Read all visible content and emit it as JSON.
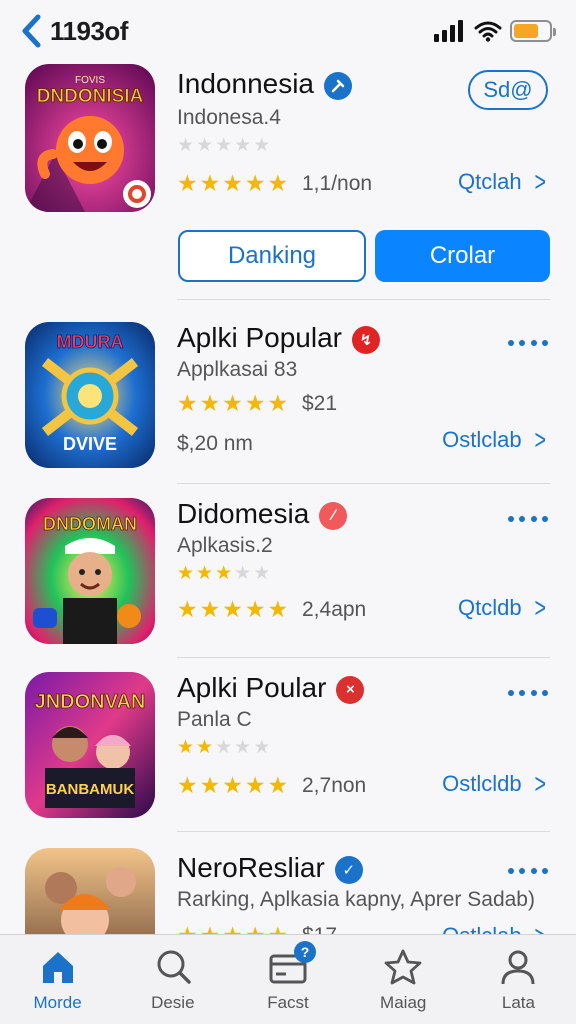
{
  "status_bar": {
    "back_label": "1193of",
    "battery_color": "#f5a623",
    "battery_level": 0.7
  },
  "featured": {
    "icon_text": "FOVIS",
    "icon_title": "DNDONISIA",
    "title": "Indonnesia",
    "subtitle": "Indonesa.4",
    "small_rating": 0,
    "rating": 4.5,
    "rating_count": "1,1/non",
    "pill_label": "Sd@",
    "link_label": "Qtclah",
    "button_secondary": "Danking",
    "button_primary": "Crolar",
    "badge_color": "#1a73c8"
  },
  "apps": [
    {
      "icon_top": "MDURA",
      "icon_bottom": "DVIVE",
      "title": "Aplki Popular",
      "subtitle": "Applkasai 83",
      "rating": 4.5,
      "price": "$21",
      "size": "$,20 nm",
      "link_label": "Ostlclab",
      "badge_color": "#e02424"
    },
    {
      "icon_top": "DNDOMAN",
      "title": "Didomesia",
      "subtitle": "Aplkasis.2",
      "small_rating": 3,
      "rating": 4.5,
      "meta": "2,4apn",
      "link_label": "Qtcldb",
      "badge_color": "#f05a5a"
    },
    {
      "icon_top": "JNDONVAN",
      "icon_bottom": "BANBAMUK",
      "title": "Aplki Poular",
      "subtitle": "Panla C",
      "small_rating": 2,
      "rating": 5,
      "meta": "2,7non",
      "link_label": "Ostlcldb",
      "badge_color": "#d93030"
    },
    {
      "title": "NeroResliar",
      "subtitle": "Rarking, Aplkasia kapny,  Aprer Sadab)",
      "rating": 5,
      "meta": "$17",
      "link_label": "Ostlclab",
      "badge_color": "#1a73c8"
    }
  ],
  "tabs": [
    {
      "label": "Morde",
      "icon": "home-icon",
      "active": true
    },
    {
      "label": "Desie",
      "icon": "search-icon",
      "active": false
    },
    {
      "label": "Facst",
      "icon": "wallet-icon",
      "active": false,
      "badge": "?"
    },
    {
      "label": "Maiag",
      "icon": "star-icon",
      "active": false
    },
    {
      "label": "Lata",
      "icon": "person-icon",
      "active": false
    }
  ],
  "accent_color": "#1a73c8"
}
